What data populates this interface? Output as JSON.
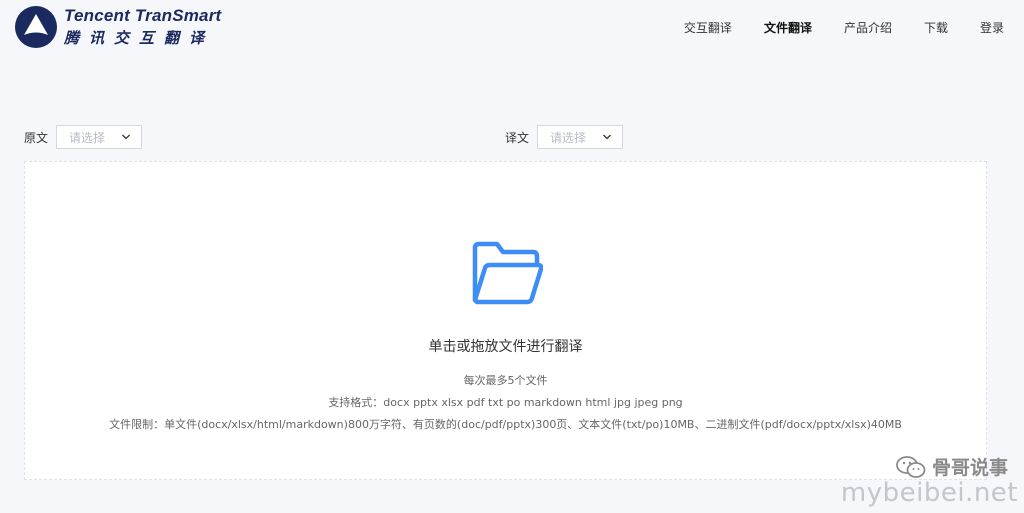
{
  "header": {
    "brand_en": "Tencent TranSmart",
    "brand_cn": "腾讯交互翻译",
    "nav": [
      {
        "label": "交互翻译",
        "active": false
      },
      {
        "label": "文件翻译",
        "active": true
      },
      {
        "label": "产品介绍",
        "active": false
      },
      {
        "label": "下载",
        "active": false
      },
      {
        "label": "登录",
        "active": false
      }
    ]
  },
  "source": {
    "label": "原文",
    "placeholder": "请选择"
  },
  "target": {
    "label": "译文",
    "placeholder": "请选择"
  },
  "dropzone": {
    "title": "单击或拖放文件进行翻译",
    "max_files": "每次最多5个文件",
    "formats": "支持格式：docx pptx xlsx pdf txt po markdown html jpg jpeg png",
    "limits": "文件限制：单文件(docx/xlsx/html/markdown)800万字符、有页数的(doc/pdf/pptx)300页、文本文件(txt/po)10MB、二进制文件(pdf/docx/pptx/xlsx)40MB"
  },
  "watermark": {
    "wechat": "骨哥说事",
    "site": "mybeibei.net"
  },
  "colors": {
    "brand": "#1b2a5e",
    "accent": "#3d8df5",
    "background": "#f6f7fb"
  }
}
